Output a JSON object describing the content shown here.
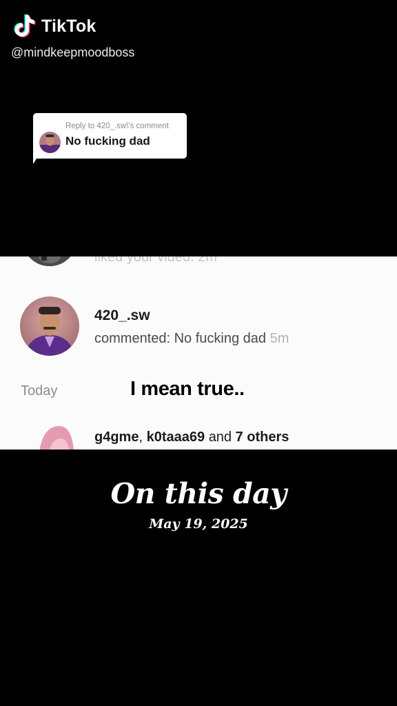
{
  "watermark": {
    "brand": "TikTok",
    "handle": "@mindkeepmoodboss",
    "icon": "tiktok-note-icon"
  },
  "reply": {
    "label": "Reply to 420_.sw\\'s comment",
    "text": "No fucking dad"
  },
  "notifications": {
    "cut_off_text": "liked your video. 2m",
    "main": {
      "username": "420_.sw",
      "comment_prefix": "commented: No fucking dad",
      "time": "5m"
    },
    "section_label": "Today",
    "caption": "I mean true..",
    "group": {
      "user_a": "g4gme",
      "separator": ",",
      "user_b": "k0taaa69",
      "and_label": "and",
      "others": "7 others"
    }
  },
  "on_this_day": {
    "title": "On this day",
    "date": "May 19, 2025"
  },
  "colors": {
    "background": "#000000",
    "panel": "#fbfbfb",
    "tiktok_cyan": "#25f4ee",
    "tiktok_red": "#fe2c55"
  }
}
